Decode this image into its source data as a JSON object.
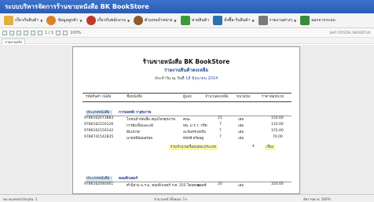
{
  "window": {
    "title": "ระบบบริหารจัดการร้านขายหนังสือ BK BookStore"
  },
  "menu": [
    {
      "label": "เกี่ยวกับสินค้า",
      "icon": "book-icon",
      "color": "#e0b040",
      "dropdown": true
    },
    {
      "label": "ข้อมูลลูกค้า",
      "icon": "customer-icon",
      "color": "#d9822b",
      "dropdown": true
    },
    {
      "label": "เกี่ยวกับพนักงาน",
      "icon": "employee-icon",
      "color": "#c0392b",
      "dropdown": true
    },
    {
      "label": "ตัวแทนจำหน่าย",
      "icon": "dealer-icon",
      "color": "#8e5b2d",
      "dropdown": true
    },
    {
      "label": "ขายสินค้า",
      "icon": "sell-icon",
      "color": "#3a9a3a",
      "dropdown": false
    },
    {
      "label": "สั่งซื้อ-รับสินค้า",
      "icon": "order-icon",
      "color": "#2f6fb0",
      "dropdown": true
    },
    {
      "label": "รายงานต่างๆ",
      "icon": "report-icon",
      "color": "#7a7a7a",
      "dropdown": true
    },
    {
      "label": "ออกจากระบบ",
      "icon": "exit-icon",
      "color": "#3a8a3a",
      "dropdown": false
    }
  ],
  "report_toolbar": {
    "page_text": "1 / 1",
    "zoom_text": "100%",
    "right_text": "SAP CRYSTAL REPORTS®"
  },
  "tab": {
    "label": "รายงานหลัก"
  },
  "report": {
    "store_name": "ร้านขายหนังสือ BK BookStore",
    "title": "รายงานสินค้าคงเหลือ",
    "date_label": "ประจำวัน ณ วันที่",
    "date_value": "18 มิถุนายน 2014",
    "columns": [
      "รหัสสินค้า ISBN",
      "ชื่อหนังสือ",
      "ผู้แต่ง",
      "จำนวนคงเหลือ",
      "หน่วยนับ",
      "ราคาต่อหน่วย"
    ],
    "group_label": "ประเภทหนังสือ :",
    "groups": [
      {
        "name": "การแพทย์-วาสุขภาพ",
        "rows": [
          {
            "isbn": "9786162073883",
            "title": "โภชนบำบัดเพื่อ สมุนไพรสุขภาพ",
            "author": "คณะ",
            "qty": "15",
            "unit": "เล่ม",
            "price": "150.00"
          },
          {
            "isbn": "9786162150126",
            "title": "การฝังเข็มและแพ้",
            "author": "ทพ. ม.ร.ว. กรีต",
            "qty": "7",
            "unit": "เล่ม",
            "price": "110.00"
          },
          {
            "isbn": "9786162150142",
            "title": "ดีแม่ปวด",
            "author": "อะจันทรเฟอรัม",
            "qty": "7",
            "unit": "เล่ม",
            "price": "155.00"
          },
          {
            "isbn": "9786741542835",
            "title": "นายหมีน้อยอร่อย",
            "author": "พัชรสี สร้อยคู",
            "qty": "7",
            "unit": "เล่ม",
            "price": "70.00"
          }
        ],
        "subtotal_label": "รวมจำนวนเรื่องแต่ละประเภท",
        "subtotal_value": "4",
        "subtotal_unit": "เรื่อง"
      },
      {
        "name": "คอมพิวเตอร์",
        "rows": [
          {
            "isbn": "9786162040461",
            "title": "คำนิยาม ม.ร.ม. คอมพิวเตอร์ ร.ศ. 255 โดยคณะ",
            "author": "คอลซ์",
            "qty": "20",
            "unit": "เล่ม",
            "price": "320.00"
          }
        ]
      }
    ]
  },
  "statusbar": {
    "left": "หมายเลขหน้าปัจจุบัน: 1",
    "middle": "จำนวนหน้าทั้งหมด: 1+",
    "right": "อัตราขยาย: 100%"
  }
}
